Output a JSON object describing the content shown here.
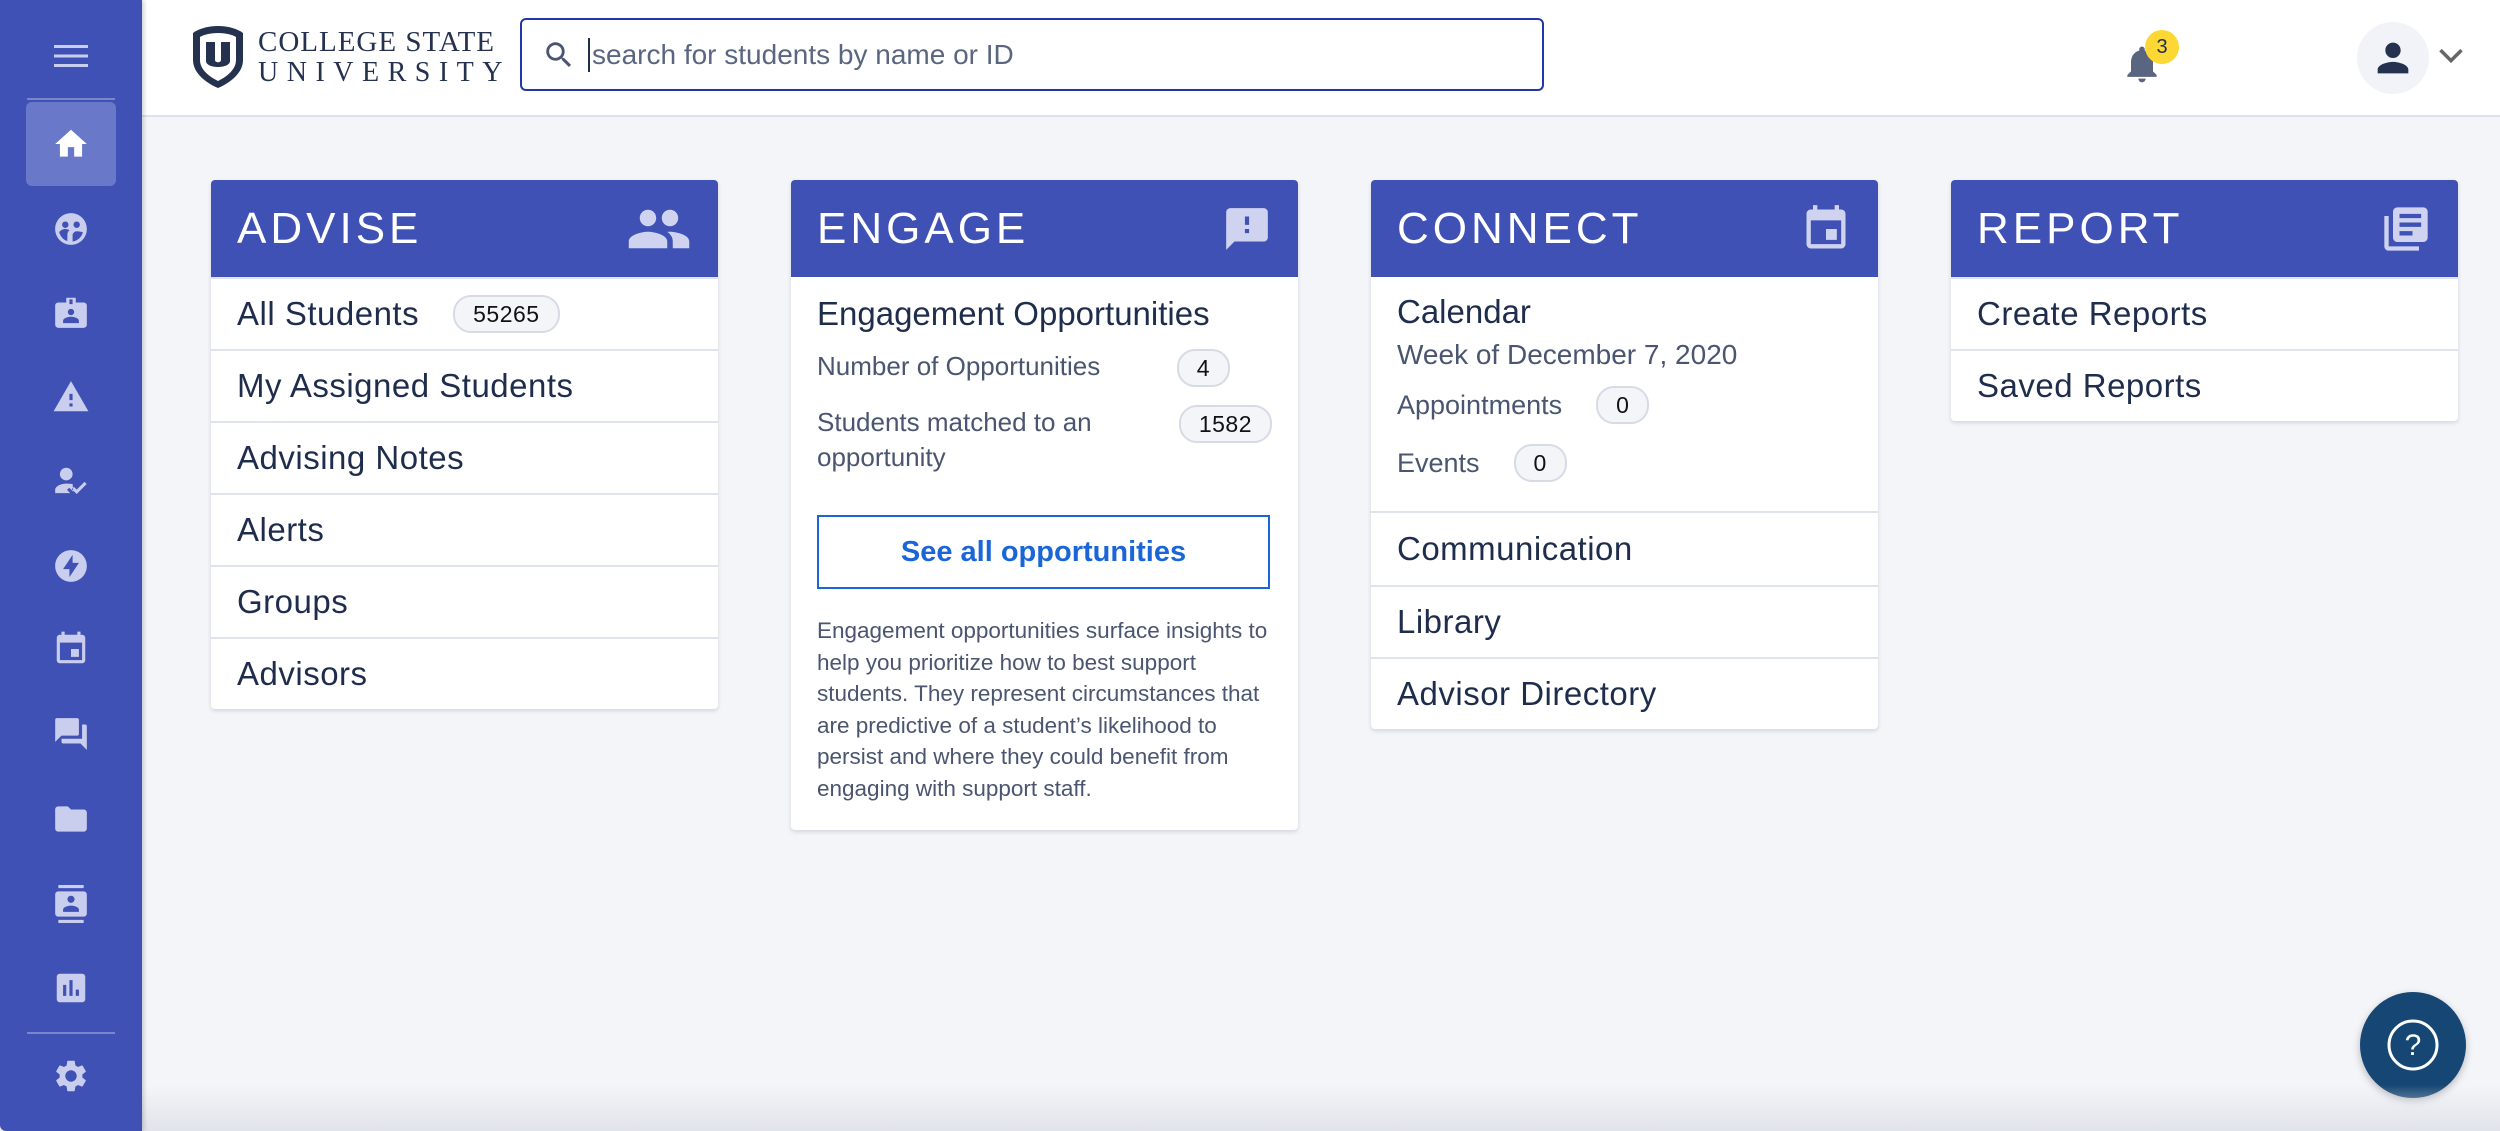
{
  "sidebar": {
    "menu_icon": "hamburger-menu-icon",
    "items": [
      {
        "id": "home",
        "icon": "home-icon",
        "active": true
      },
      {
        "id": "students",
        "icon": "groups-icon",
        "active": false
      },
      {
        "id": "student-profile",
        "icon": "badge-icon",
        "active": false
      },
      {
        "id": "alerts",
        "icon": "warning-icon",
        "active": false
      },
      {
        "id": "assigned",
        "icon": "person-check-icon",
        "active": false
      },
      {
        "id": "engage",
        "icon": "bolt-icon",
        "active": false
      },
      {
        "id": "calendar",
        "icon": "calendar-icon",
        "active": false
      },
      {
        "id": "communication",
        "icon": "chat-icon",
        "active": false
      },
      {
        "id": "library",
        "icon": "folder-icon",
        "active": false
      },
      {
        "id": "directory",
        "icon": "contacts-icon",
        "active": false
      },
      {
        "id": "reports",
        "icon": "bar-chart-icon",
        "active": false
      }
    ],
    "settings_icon": "gear-icon"
  },
  "header": {
    "logo_line1": "COLLEGE STATE",
    "logo_line2": "UNIVERSITY",
    "search_placeholder": "search for students by name or ID",
    "search_value": "",
    "notification_count": "3"
  },
  "colors": {
    "primary": "#3f51b5",
    "link": "#1a66d8",
    "badge": "#fdd835",
    "help": "#164673"
  },
  "cards": {
    "advise": {
      "title": "ADVISE",
      "icon": "people-icon",
      "rows": [
        {
          "label": "All Students",
          "count": "55265"
        },
        {
          "label": "My Assigned Students"
        },
        {
          "label": "Advising Notes"
        },
        {
          "label": "Alerts"
        },
        {
          "label": "Groups"
        },
        {
          "label": "Advisors"
        }
      ]
    },
    "engage": {
      "title": "ENGAGE",
      "icon": "feedback-icon",
      "subtitle": "Engagement Opportunities",
      "stats": [
        {
          "label": "Number of Opportunities",
          "value": "4"
        },
        {
          "label": "Students matched to an opportunity",
          "value": "1582"
        }
      ],
      "button_label": "See all opportunities",
      "description": "Engagement opportunities surface insights to help you prioritize how to best support students. They represent circumstances that are predictive of a student’s likelihood to persist and where they could benefit from engaging with support staff."
    },
    "connect": {
      "title": "CONNECT",
      "icon": "calendar-icon",
      "calendar_title": "Calendar",
      "week_label": "Week of December 7, 2020",
      "appointments_label": "Appointments",
      "appointments_value": "0",
      "events_label": "Events",
      "events_value": "0",
      "rows": [
        {
          "label": "Communication"
        },
        {
          "label": "Library"
        },
        {
          "label": "Advisor Directory"
        }
      ]
    },
    "report": {
      "title": "REPORT",
      "icon": "library-books-icon",
      "rows": [
        {
          "label": "Create Reports"
        },
        {
          "label": "Saved Reports"
        }
      ]
    }
  },
  "help_button": {
    "icon": "help-circle-icon"
  }
}
